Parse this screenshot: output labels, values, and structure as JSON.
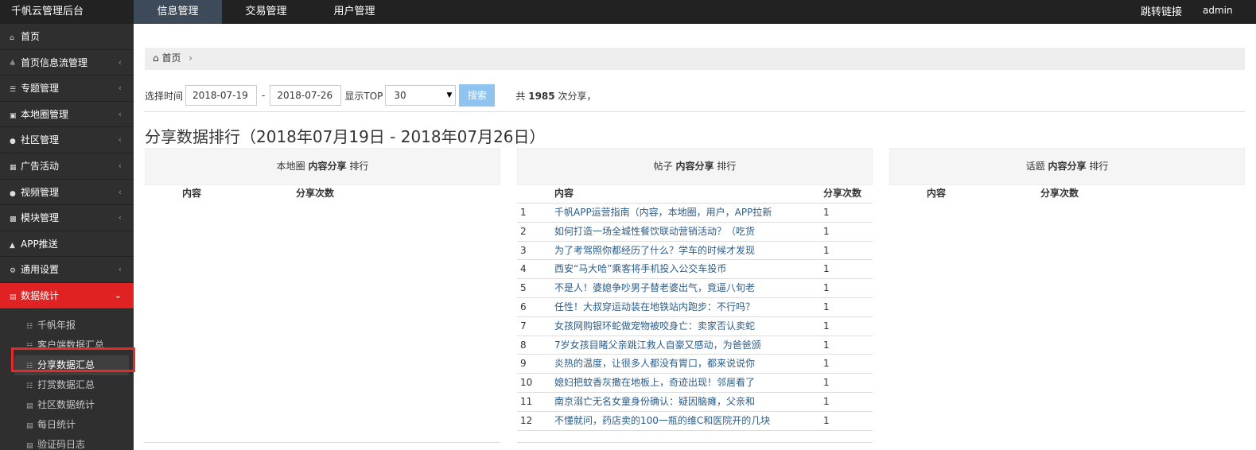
{
  "topbar": {
    "brand": "千帆云管理后台",
    "nav": [
      "信息管理",
      "交易管理",
      "用户管理"
    ],
    "jump_link": "跳转链接",
    "admin": "admin"
  },
  "sidebar": {
    "items": [
      {
        "label": "首页",
        "icon": "home-icon"
      },
      {
        "label": "首页信息流管理",
        "icon": "rss-icon"
      },
      {
        "label": "专题管理",
        "icon": "list-icon"
      },
      {
        "label": "本地圈管理",
        "icon": "image-icon"
      },
      {
        "label": "社区管理",
        "icon": "users-icon"
      },
      {
        "label": "广告活动",
        "icon": "calendar-icon"
      },
      {
        "label": "视频管理",
        "icon": "users-icon"
      },
      {
        "label": "模块管理",
        "icon": "sitemap-icon"
      },
      {
        "label": "APP推送",
        "icon": "bell-icon"
      },
      {
        "label": "通用设置",
        "icon": "cogs-icon"
      },
      {
        "label": "数据统计",
        "icon": "bar-chart-icon"
      }
    ],
    "sub_items": [
      {
        "label": "千帆年报"
      },
      {
        "label": "客户端数据汇总"
      },
      {
        "label": "分享数据汇总"
      },
      {
        "label": "打赏数据汇总"
      },
      {
        "label": "社区数据统计"
      },
      {
        "label": "每日统计"
      },
      {
        "label": "验证码日志"
      }
    ]
  },
  "breadcrumb": {
    "home": "首页"
  },
  "filter": {
    "label": "选择时间",
    "start_date": "2018-07-19",
    "end_date": "2018-07-26",
    "dash": "-",
    "top_label": "显示TOP",
    "top_value": "30",
    "search": "搜索",
    "total_prefix": "共",
    "total_count": "1985",
    "total_suffix": "次分享，"
  },
  "page_title": "分享数据排行（2018年07月19日 - 2018年07月26日）",
  "panels": [
    {
      "pre": "本地圈",
      "bold": "内容分享",
      "post": "排行",
      "col_content": "内容",
      "col_count": "分享次数",
      "rows": []
    },
    {
      "pre": "帖子",
      "bold": "内容分享",
      "post": "排行",
      "col_content": "内容",
      "col_count": "分享次数",
      "rows": [
        {
          "idx": "1",
          "text": "千帆APP运营指南（内容，本地圈，用户，APP拉新",
          "count": "1"
        },
        {
          "idx": "2",
          "text": "如何打造一场全城性餐饮联动营销活动？（吃货",
          "count": "1"
        },
        {
          "idx": "3",
          "text": "为了考驾照你都经历了什么？学车的时候才发现",
          "count": "1"
        },
        {
          "idx": "4",
          "text": "西安“马大哈”乘客将手机投入公交车投币",
          "count": "1"
        },
        {
          "idx": "5",
          "text": "不是人！婆媳争吵男子替老婆出气，竟逼八旬老",
          "count": "1"
        },
        {
          "idx": "6",
          "text": "任性！大叔穿运动装在地铁站内跑步：不行吗？",
          "count": "1"
        },
        {
          "idx": "7",
          "text": "女孩网购银环蛇做宠物被咬身亡：卖家否认卖蛇",
          "count": "1"
        },
        {
          "idx": "8",
          "text": "7岁女孩目睹父亲跳江救人自豪又感动，为爸爸颁",
          "count": "1"
        },
        {
          "idx": "9",
          "text": "炎热的温度，让很多人都没有胃口，都来说说你",
          "count": "1"
        },
        {
          "idx": "10",
          "text": "媳妇把蚊香灰撒在地板上，奇迹出现！邻居看了",
          "count": "1"
        },
        {
          "idx": "11",
          "text": "南京溺亡无名女童身份确认：疑因脑瘫，父亲和",
          "count": "1"
        },
        {
          "idx": "12",
          "text": "不懂就问，药店卖的100一瓶的维C和医院开的几块",
          "count": "1"
        }
      ]
    },
    {
      "pre": "话题",
      "bold": "内容分享",
      "post": "排行",
      "col_content": "内容",
      "col_count": "分享次数",
      "rows": []
    }
  ]
}
